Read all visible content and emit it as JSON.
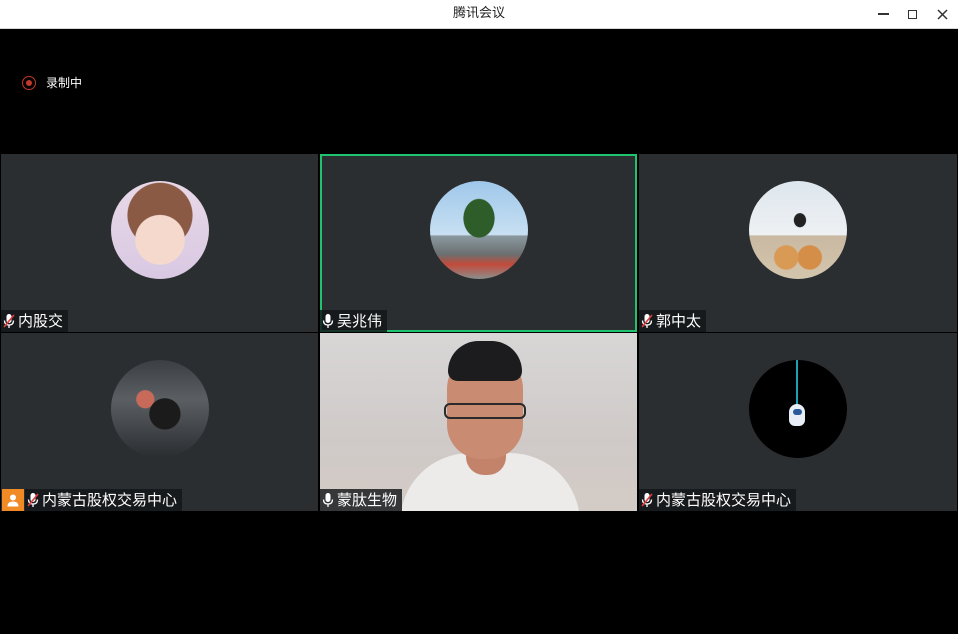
{
  "window": {
    "title": "腾讯会议"
  },
  "recording": {
    "label": "录制中"
  },
  "participants": [
    {
      "name": "内股交",
      "mic": "muted",
      "avatar": "girl-avatar",
      "active": false
    },
    {
      "name": "吴兆伟",
      "mic": "on",
      "avatar": "tree-avatar",
      "active": true
    },
    {
      "name": "郭中太",
      "mic": "muted",
      "avatar": "dogs-avatar",
      "active": false
    },
    {
      "name": "内蒙古股权交易中心",
      "mic": "muted",
      "avatar": "car-avatar",
      "active": false,
      "host": true
    },
    {
      "name": "蒙肽生物",
      "mic": "on",
      "avatar": "video",
      "active": false
    },
    {
      "name": "内蒙古股权交易中心",
      "mic": "muted",
      "avatar": "astronaut-avatar",
      "active": false
    }
  ],
  "colors": {
    "active_border": "#1ec26f",
    "host_badge": "#f08a24",
    "recording": "#c0392b",
    "tile_bg": "#2b2e31"
  }
}
